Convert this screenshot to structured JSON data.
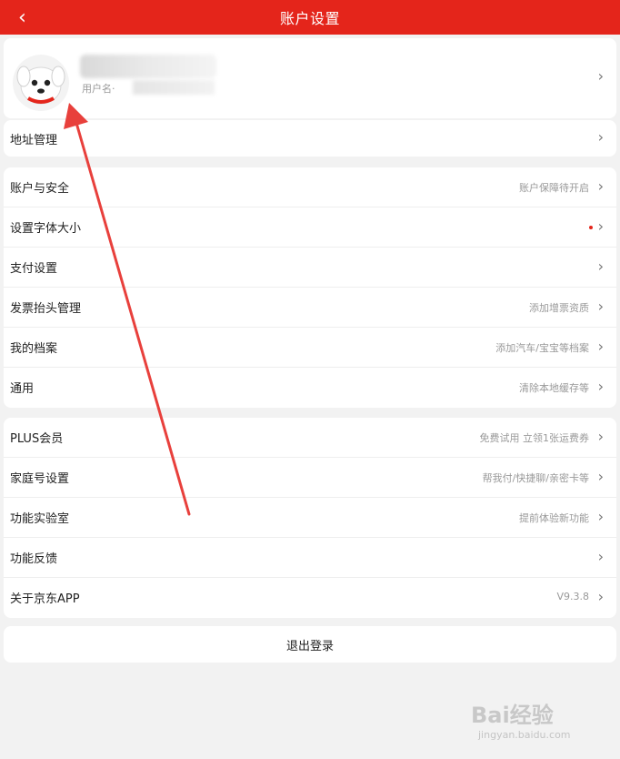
{
  "header": {
    "title": "账户设置",
    "back_icon": "‹"
  },
  "profile": {
    "username_prefix": "用户名·",
    "chevron": "›"
  },
  "address": {
    "label": "地址管理",
    "chevron": "›"
  },
  "group1": {
    "items": [
      {
        "label": "账户与安全",
        "value": "账户保障待开启",
        "chevron": "›"
      },
      {
        "label": "设置字体大小",
        "value": "",
        "chevron": "›"
      },
      {
        "label": "支付设置",
        "value": "",
        "chevron": "›"
      },
      {
        "label": "发票抬头管理",
        "value": "添加增票资质",
        "chevron": "›"
      },
      {
        "label": "我的档案",
        "value": "添加汽车/宝宝等档案",
        "chevron": "›"
      },
      {
        "label": "通用",
        "value": "清除本地缓存等",
        "chevron": "›"
      }
    ]
  },
  "group2": {
    "items": [
      {
        "label": "PLUS会员",
        "value": "免费试用 立领1张运费券",
        "chevron": "›"
      },
      {
        "label": "家庭号设置",
        "value": "帮我付/快捷聊/亲密卡等",
        "chevron": "›"
      },
      {
        "label": "功能实验室",
        "value": "提前体验新功能",
        "chevron": "›"
      },
      {
        "label": "功能反馈",
        "value": "",
        "chevron": "›"
      },
      {
        "label": "关于京东APP",
        "value": "V9.3.8",
        "chevron": "›"
      }
    ]
  },
  "logout": {
    "label": "退出登录"
  },
  "watermark": {
    "main": "Bai经验",
    "sub": "jingyan.baidu.com"
  },
  "colors": {
    "header_red": "#e4251b",
    "annotation_arrow": "#e8403c"
  }
}
